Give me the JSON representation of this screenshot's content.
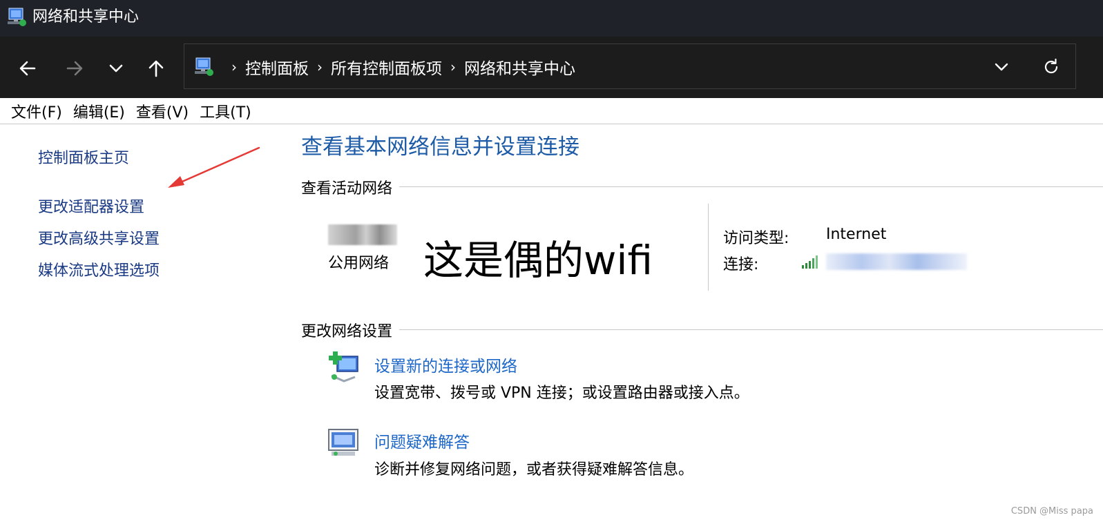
{
  "window": {
    "title": "网络和共享中心",
    "icon": "network-center-icon"
  },
  "navigation": {
    "back_icon": "arrow-left-icon",
    "forward_icon": "arrow-right-icon",
    "recent_icon": "chevron-down-icon",
    "up_icon": "arrow-up-icon"
  },
  "address_bar": {
    "crumbs": [
      "控制面板",
      "所有控制面板项",
      "网络和共享中心"
    ],
    "separator": "›",
    "dropdown_icon": "chevron-down-icon",
    "refresh_icon": "refresh-icon"
  },
  "menu": {
    "items": [
      "文件(F)",
      "编辑(E)",
      "查看(V)",
      "工具(T)"
    ]
  },
  "sidebar": {
    "home": "控制面板主页",
    "links": [
      "更改适配器设置",
      "更改高级共享设置",
      "媒体流式处理选项"
    ]
  },
  "main": {
    "heading": "查看基本网络信息并设置连接",
    "active_network": {
      "section_title": "查看活动网络",
      "network_name": "这是偶的wifi",
      "network_type": "公用网络",
      "access_type_label": "访问类型:",
      "access_type_value": "Internet",
      "connection_label": "连接:"
    },
    "change_settings": {
      "section_title": "更改网络设置",
      "tasks": [
        {
          "link": "设置新的连接或网络",
          "description": "设置宽带、拨号或 VPN 连接；或设置路由器或接入点。",
          "icon": "new-connection-icon"
        },
        {
          "link": "问题疑难解答",
          "description": "诊断并修复网络问题，或者获得疑难解答信息。",
          "icon": "troubleshoot-icon"
        }
      ]
    }
  },
  "watermark": "CSDN @Miss papa",
  "colors": {
    "titlebar_bg": "#1f2329",
    "navbar_bg": "#1c1c1c",
    "heading": "#1d5ba7",
    "link": "#1d67c8",
    "sidebar_link": "#1a3a84",
    "annotation_arrow": "#e53935"
  }
}
